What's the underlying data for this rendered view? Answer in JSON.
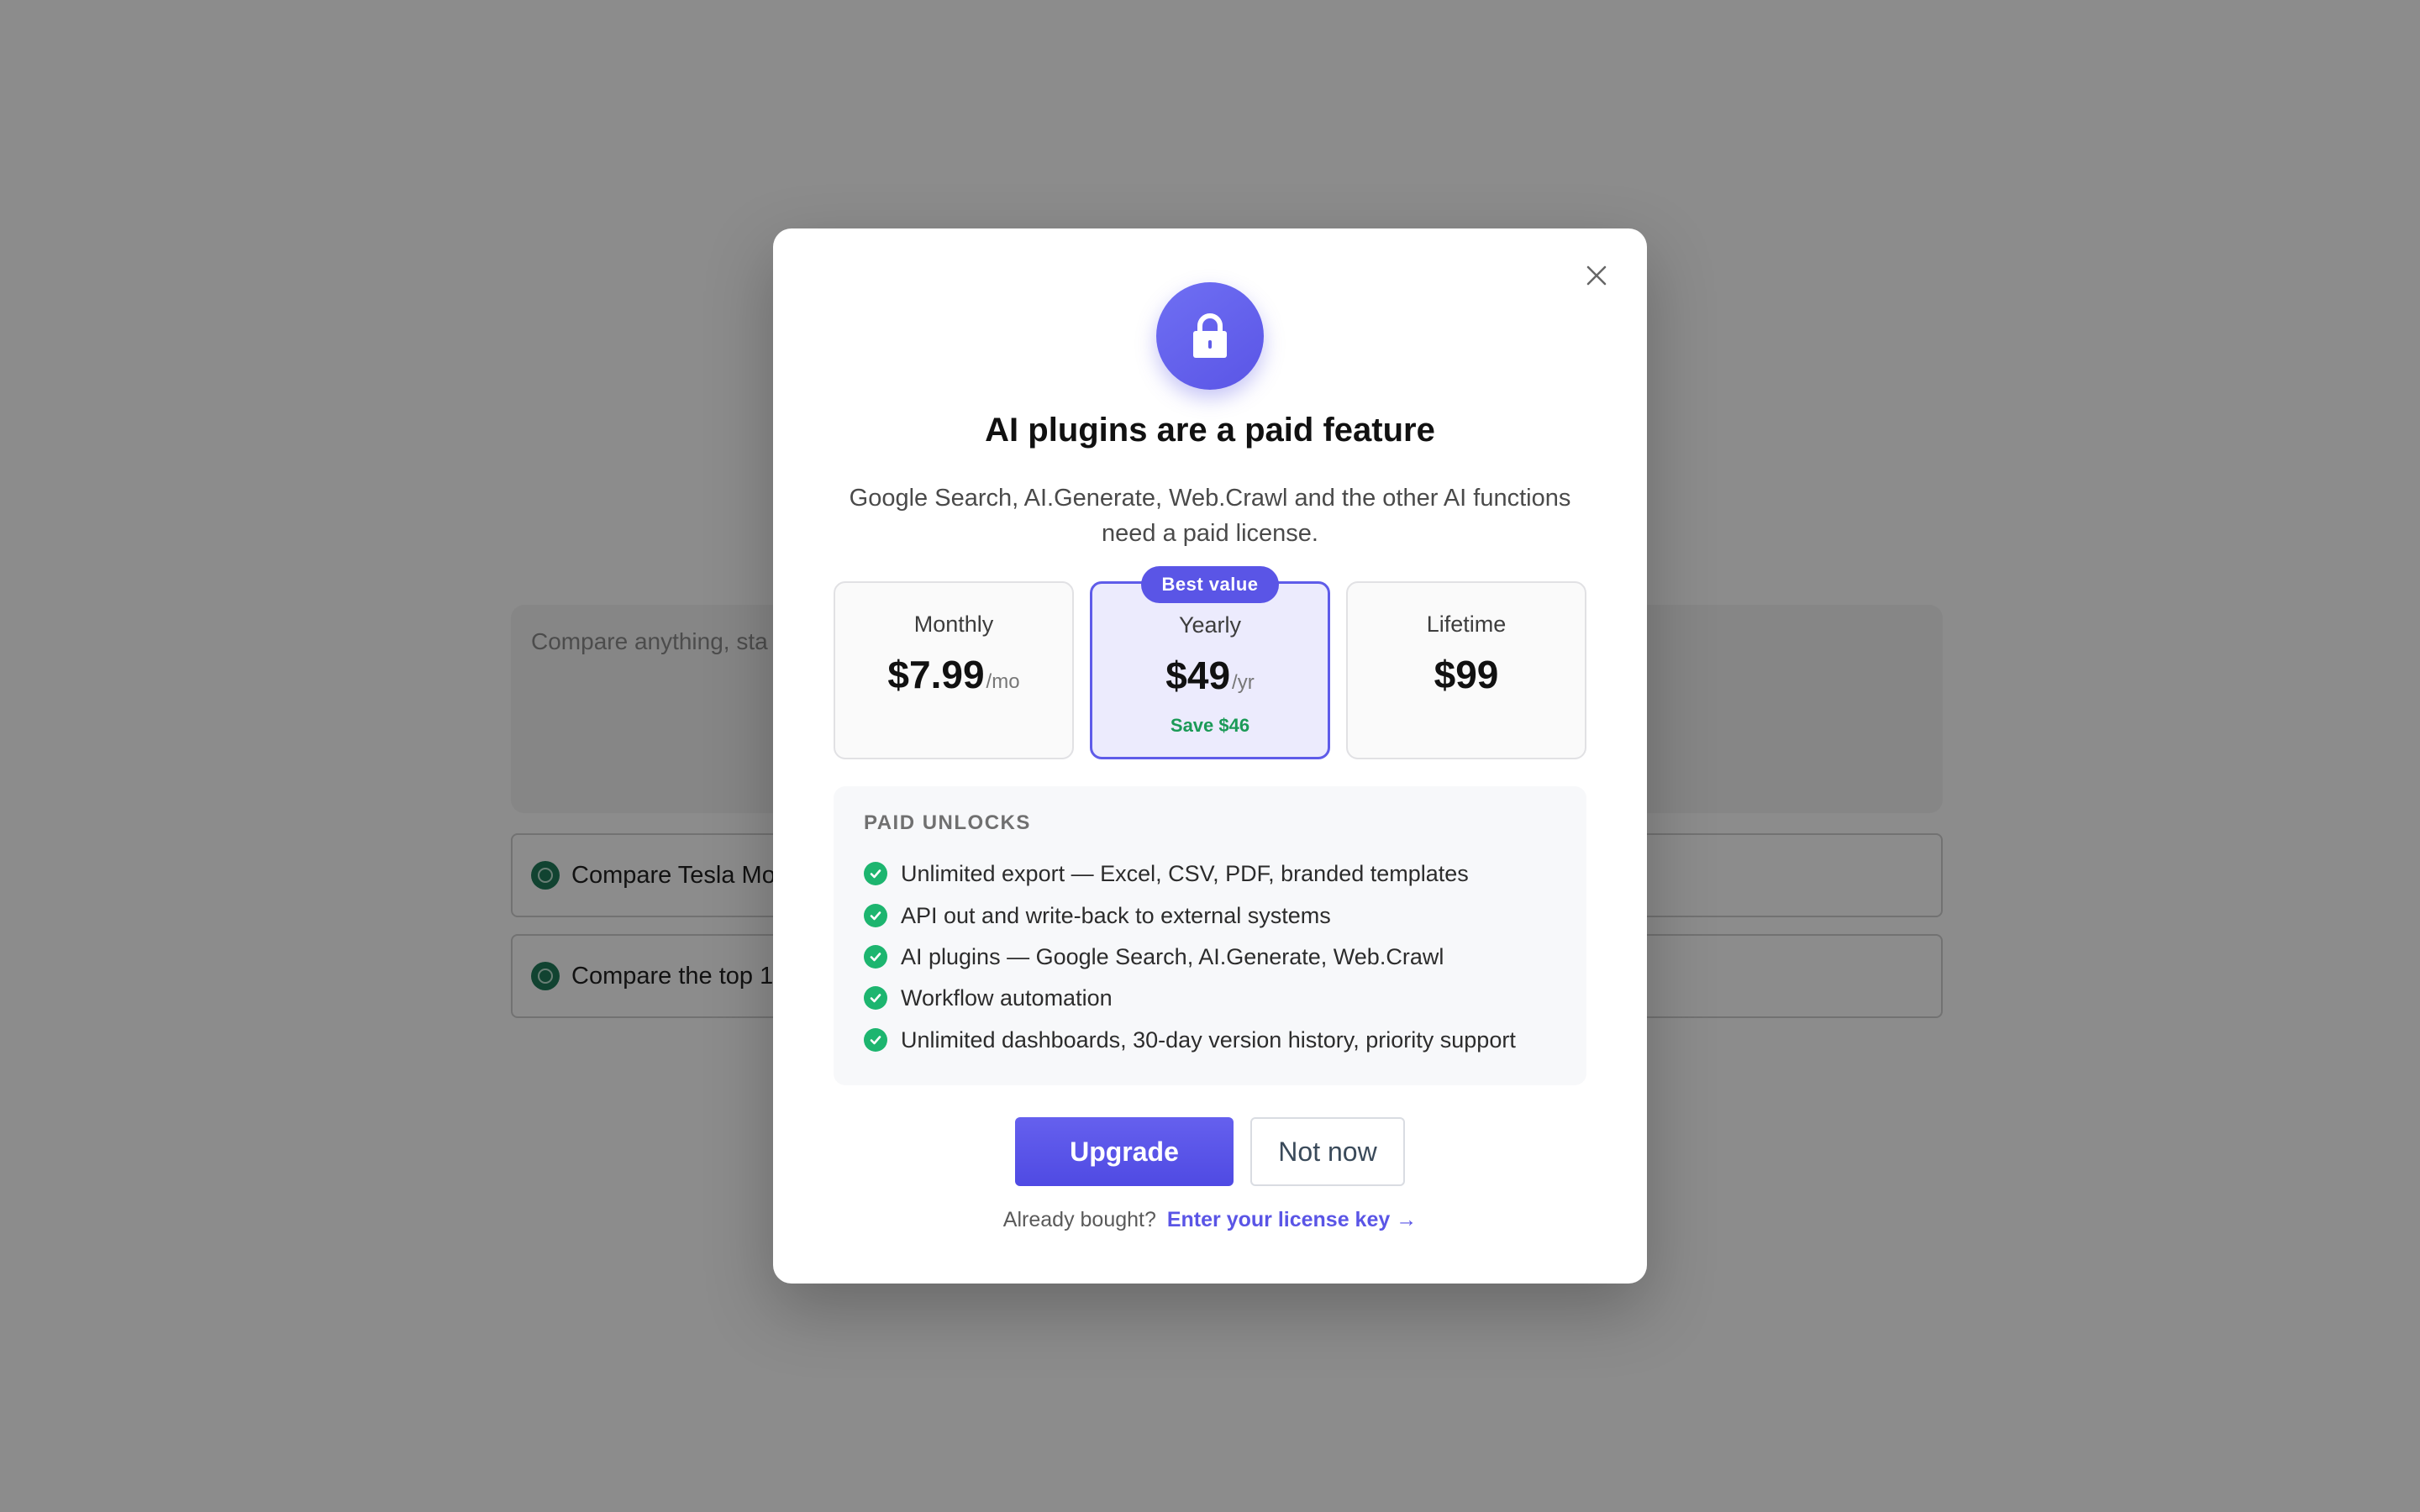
{
  "background": {
    "prompt_placeholder": "Compare anything, sta",
    "suggestions": [
      {
        "label": "Compare Tesla Mod"
      },
      {
        "label": "Compare the top 1"
      }
    ]
  },
  "modal": {
    "title": "AI plugins are a paid feature",
    "subtitle": "Google Search, AI.Generate, Web.Crawl and the other AI functions need a paid license.",
    "icons": {
      "header": "lock-icon",
      "close": "close-icon",
      "check": "check-icon"
    },
    "badge": "Best value",
    "plans": [
      {
        "name": "Monthly",
        "price": "$7.99",
        "unit": "/mo",
        "note": ""
      },
      {
        "name": "Yearly",
        "price": "$49",
        "unit": "/yr",
        "note": "Save $46",
        "selected": true
      },
      {
        "name": "Lifetime",
        "price": "$99",
        "unit": "",
        "note": ""
      }
    ],
    "unlocks": {
      "heading": "PAID UNLOCKS",
      "items": [
        "Unlimited export — Excel, CSV, PDF, branded templates",
        "API out and write-back to external systems",
        "AI plugins — Google Search, AI.Generate, Web.Crawl",
        "Workflow automation",
        "Unlimited dashboards, 30-day version history, priority support"
      ]
    },
    "actions": {
      "upgrade": "Upgrade",
      "not_now": "Not now"
    },
    "footer": {
      "text": "Already bought?",
      "link": "Enter your license key →"
    },
    "colors": {
      "accent": "#5a55e6",
      "success": "#1db56f",
      "save_text": "#1b9a57"
    }
  }
}
